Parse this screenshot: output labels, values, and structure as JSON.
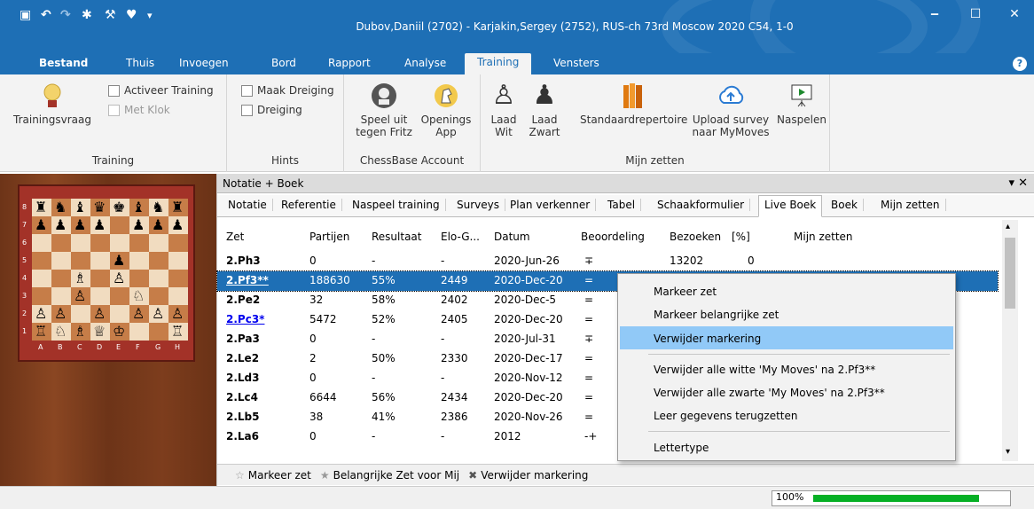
{
  "window": {
    "title": "Dubov,Daniil (2702) - Karjakin,Sergey (2752), RUS-ch 73rd Moscow 2020  C54, 1-0",
    "minimize": "‒",
    "maximize": "☐",
    "close": "✕"
  },
  "menubar": {
    "items": [
      "Bestand",
      "Thuis",
      "Invoegen",
      "Bord",
      "Rapport",
      "Analyse",
      "Training",
      "Vensters"
    ],
    "help": "?"
  },
  "ribbon": {
    "training_group": {
      "label": "Training",
      "trainingsvraag": "Trainingsvraag",
      "activeer_training": "Activeer Training",
      "met_klok": "Met Klok"
    },
    "hints_group": {
      "label": "Hints",
      "maak_dreiging": "Maak Dreiging",
      "dreiging": "Dreiging"
    },
    "account_group": {
      "label": "ChessBase Account",
      "speel_uit_1": "Speel uit",
      "speel_uit_2": "tegen Fritz",
      "openings_1": "Openings",
      "openings_2": "App"
    },
    "mijn_group": {
      "label": "Mijn zetten",
      "laad_wit_1": "Laad",
      "laad_wit_2": "Wit",
      "laad_zwart_1": "Laad",
      "laad_zwart_2": "Zwart",
      "standaard": "Standaardrepertoire",
      "upload_1": "Upload survey",
      "upload_2": "naar MyMoves",
      "naspelen": "Naspelen"
    }
  },
  "board": {
    "files": [
      "A",
      "B",
      "C",
      "D",
      "E",
      "F",
      "G",
      "H"
    ],
    "ranks": [
      "8",
      "7",
      "6",
      "5",
      "4",
      "3",
      "2",
      "1"
    ],
    "rows": [
      "♜♞♝♛♚♝♞♜",
      "♟♟♟♟ ♟♟♟",
      "        ",
      "    ♟   ",
      "  ♗ ♙   ",
      "  ♙  ♘  ",
      "♙♙ ♙ ♙♙♙",
      "♖♘♗♕♔  ♖"
    ]
  },
  "panel": {
    "title": "Notatie + Boek",
    "controls": "▾ ✕",
    "tabs": [
      "Notatie",
      "Referentie",
      "Naspeel training",
      "Surveys",
      "Plan verkenner",
      "Tabel",
      "Schaakformulier",
      "Live Boek",
      "Boek",
      "Mijn zetten"
    ],
    "active_tab": "Live Boek",
    "columns": [
      "Zet",
      "Partijen",
      "Resultaat",
      "Elo-G...",
      "Datum",
      "Beoordeling",
      "Bezoeken",
      "[%]",
      "Mijn zetten"
    ],
    "rows": [
      {
        "zet": "2.Ph3",
        "partijen": "0",
        "resultaat": "-",
        "elo": "-",
        "datum": "2020-Jun-26",
        "beoordeling": "∓",
        "bezoeken": "13202",
        "pct": "0",
        "style": "bold"
      },
      {
        "zet": "2.Pf3**",
        "partijen": "188630",
        "resultaat": "55%",
        "elo": "2449",
        "datum": "2020-Dec-20",
        "beoordeling": "=",
        "bezoeken": "",
        "pct": "",
        "style": "sel"
      },
      {
        "zet": "2.Pe2",
        "partijen": "32",
        "resultaat": "58%",
        "elo": "2402",
        "datum": "2020-Dec-5",
        "beoordeling": "=",
        "bezoeken": "",
        "pct": "",
        "style": "bold"
      },
      {
        "zet": "2.Pc3*",
        "partijen": "5472",
        "resultaat": "52%",
        "elo": "2405",
        "datum": "2020-Dec-20",
        "beoordeling": "=",
        "bezoeken": "",
        "pct": "",
        "style": "link"
      },
      {
        "zet": "2.Pa3",
        "partijen": "0",
        "resultaat": "-",
        "elo": "-",
        "datum": "2020-Jul-31",
        "beoordeling": "∓",
        "bezoeken": "",
        "pct": "",
        "style": "bold"
      },
      {
        "zet": "2.Le2",
        "partijen": "2",
        "resultaat": "50%",
        "elo": "2330",
        "datum": "2020-Dec-17",
        "beoordeling": "=",
        "bezoeken": "",
        "pct": "",
        "style": "bold"
      },
      {
        "zet": "2.Ld3",
        "partijen": "0",
        "resultaat": "-",
        "elo": "-",
        "datum": "2020-Nov-12",
        "beoordeling": "=",
        "bezoeken": "",
        "pct": "",
        "style": "bold"
      },
      {
        "zet": "2.Lc4",
        "partijen": "6644",
        "resultaat": "56%",
        "elo": "2434",
        "datum": "2020-Dec-20",
        "beoordeling": "=",
        "bezoeken": "",
        "pct": "",
        "style": "bold"
      },
      {
        "zet": "2.Lb5",
        "partijen": "38",
        "resultaat": "41%",
        "elo": "2386",
        "datum": "2020-Nov-26",
        "beoordeling": "=",
        "bezoeken": "",
        "pct": "",
        "style": "bold"
      },
      {
        "zet": "2.La6",
        "partijen": "0",
        "resultaat": "-",
        "elo": "-",
        "datum": "2012",
        "beoordeling": "-+",
        "bezoeken": "",
        "pct": "",
        "style": "bold"
      }
    ],
    "bottom_bar": {
      "markeer": "Markeer zet",
      "belangrijk": "Belangrijke Zet voor Mij",
      "verwijder": "Verwijder markering"
    }
  },
  "context_menu": {
    "items": [
      "Markeer zet",
      "Markeer belangrijke zet",
      "Verwijder markering",
      "Verwijder alle witte 'My Moves' na 2.Pf3**",
      "Verwijder alle zwarte 'My Moves' na 2.Pf3**",
      "Leer gegevens terugzetten",
      "Lettertype"
    ],
    "highlighted": "Verwijder markering"
  },
  "status": {
    "zoom": "100%",
    "progress": 0.85
  },
  "colors": {
    "accent": "#1e6fb5",
    "progress": "#06b025",
    "highlight": "#91c9f7"
  }
}
